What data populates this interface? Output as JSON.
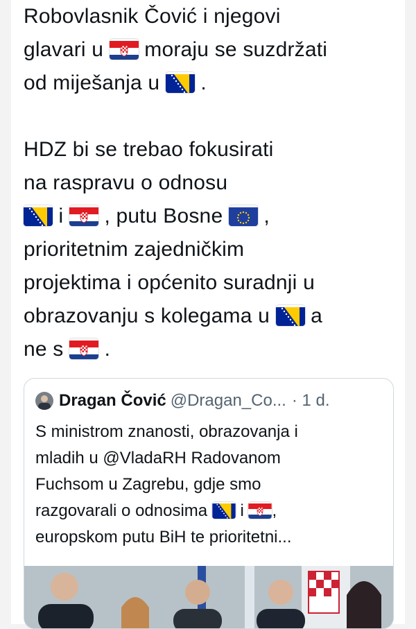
{
  "tweet": {
    "lines1": [
      {
        "text": "Robovlasnik Čović i njegovi"
      },
      {
        "text": "glavari u ",
        "flag": "croatia",
        "after": " moraju se suzdržati"
      },
      {
        "text": "od miješanja u ",
        "flag": "bosnia",
        "after": " ."
      }
    ],
    "line4": "HDZ bi se trebao fokusirati",
    "line5": "na raspravu o odnosu",
    "line6_mid": " i ",
    "line6_mid2": " , putu Bosne ",
    "line6_end": " ,",
    "line7": "prioritetnim zajedničkim",
    "line8": "projektima i općenito suradnji u",
    "line9_a": "obrazovanju s kolegama u ",
    "line9_b": " a",
    "line10_a": "ne s ",
    "line10_b": " ."
  },
  "quote": {
    "name": "Dragan Čović",
    "handle": "@Dragan_Co...",
    "time": "· 1 d.",
    "l1": "S ministrom znanosti, obrazovanja i",
    "l2": "mladih u @VladaRH Radovanom",
    "l3": "Fuchsom u Zagrebu, gdje smo",
    "l4a": "razgovarali o odnosima ",
    "l4b": " i ",
    "l4c": ",",
    "l5": "europskom putu BiH te prioritetni..."
  },
  "icons": [
    "croatia-flag-icon",
    "bosnia-flag-icon",
    "eu-flag-icon"
  ],
  "colors": {
    "text": "#0f1419",
    "muted": "#536471",
    "border": "#cfd9de"
  }
}
